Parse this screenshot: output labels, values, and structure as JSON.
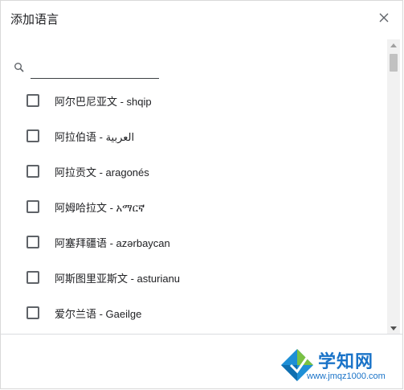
{
  "dialog": {
    "title": "添加语言",
    "close_icon": "close-icon"
  },
  "search": {
    "value": "",
    "placeholder": "",
    "icon": "search-icon"
  },
  "languages": [
    {
      "label": "阿尔巴尼亚文 - shqip",
      "checked": false
    },
    {
      "label": "阿拉伯语 - العربية",
      "checked": false
    },
    {
      "label": "阿拉贡文 - aragonés",
      "checked": false
    },
    {
      "label": "阿姆哈拉文 - አማርኛ",
      "checked": false
    },
    {
      "label": "阿塞拜疆语 - azərbaycan",
      "checked": false
    },
    {
      "label": "阿斯图里亚斯文 - asturianu",
      "checked": false
    },
    {
      "label": "爱尔兰语 - Gaeilge",
      "checked": false
    }
  ],
  "watermark": {
    "text": "学知网",
    "url": "www.jmqz1000.com"
  },
  "colors": {
    "checkbox_border": "#5f6368",
    "watermark": "#1a73c8"
  }
}
